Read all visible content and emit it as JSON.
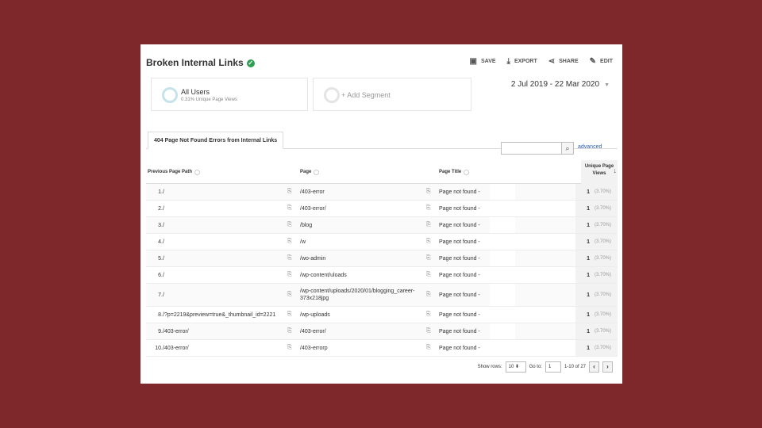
{
  "header": {
    "title": "Broken Internal Links",
    "verified_icon": "check-circle-icon",
    "actions": [
      {
        "label": "SAVE",
        "icon": "save-icon"
      },
      {
        "label": "EXPORT",
        "icon": "export-icon"
      },
      {
        "label": "SHARE",
        "icon": "share-icon"
      },
      {
        "label": "EDIT",
        "icon": "pencil-icon"
      }
    ]
  },
  "segments": {
    "active": {
      "label": "All Users",
      "sub": "0.31% Unique Page Views"
    },
    "add_label": "+ Add Segment"
  },
  "date_range": "2 Jul 2019 - 22 Mar 2020",
  "tab_label": "404 Page Not Found Errors from Internal Links",
  "search": {
    "value": "",
    "advanced_label": "advanced"
  },
  "table": {
    "headers": {
      "previous_page_path": "Previous Page Path",
      "page": "Page",
      "page_title": "Page Title",
      "unique_page_views": "Unique Page Views"
    },
    "rows": [
      {
        "num": "1.",
        "prev": "/",
        "page": "/403-error",
        "title": "Page not found -",
        "views": "1",
        "pct": "(3.70%)"
      },
      {
        "num": "2.",
        "prev": "/",
        "page": "/403-error/",
        "title": "Page not found -",
        "views": "1",
        "pct": "(3.70%)"
      },
      {
        "num": "3.",
        "prev": "/",
        "page": "/blog",
        "title": "Page not found -",
        "views": "1",
        "pct": "(3.70%)"
      },
      {
        "num": "4.",
        "prev": "/",
        "page": "/w",
        "title": "Page not found -",
        "views": "1",
        "pct": "(3.70%)"
      },
      {
        "num": "5.",
        "prev": "/",
        "page": "/wo-admin",
        "title": "Page not found -",
        "views": "1",
        "pct": "(3.70%)"
      },
      {
        "num": "6.",
        "prev": "/",
        "page": "/wp-content/uloads",
        "title": "Page not found -",
        "views": "1",
        "pct": "(3.70%)"
      },
      {
        "num": "7.",
        "prev": "/",
        "page": "/wp-content/uploads/2020/01/blogging_career-373x218jpg",
        "title": "Page not found -",
        "views": "1",
        "pct": "(3.70%)"
      },
      {
        "num": "8.",
        "prev": "/?p=2219&preview=true&_thumbnail_id=2221",
        "page": "/wp-uploads",
        "title": "Page not found -",
        "views": "1",
        "pct": "(3.70%)"
      },
      {
        "num": "9.",
        "prev": "/403-error/",
        "page": "/403-error/",
        "title": "Page not found -",
        "views": "1",
        "pct": "(3.70%)"
      },
      {
        "num": "10.",
        "prev": "/403-error/",
        "page": "/403-errorp",
        "title": "Page not found -",
        "views": "1",
        "pct": "(3.70%)"
      }
    ]
  },
  "pagination": {
    "show_rows_label": "Show rows:",
    "show_rows_value": "10",
    "goto_label": "Go to:",
    "goto_value": "1",
    "range_text": "1-10 of 27"
  },
  "colors": {
    "background": "#7e282b",
    "accent_link": "#2a5db0",
    "verified": "#2e9e53"
  }
}
